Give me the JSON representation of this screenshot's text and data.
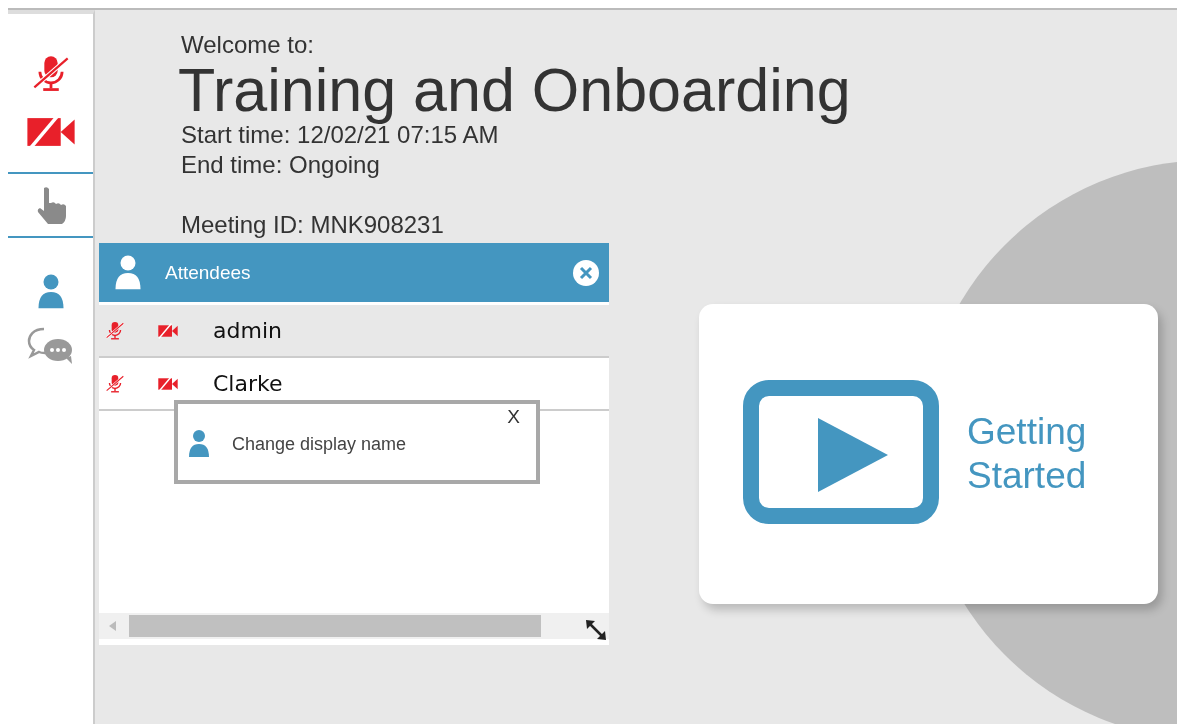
{
  "sidebar": [
    {
      "kind": "mic",
      "muted": true
    },
    {
      "kind": "camera",
      "muted": true
    },
    {
      "kind": "hand"
    },
    {
      "kind": "attendees",
      "selected": true
    },
    {
      "kind": "chat",
      "selected": false
    }
  ],
  "welcome": {
    "label": "Welcome to:",
    "title": "Training and Onboarding",
    "start_time": "Start time: 12/02/21 07:15 AM",
    "end_time": "End time: Ongoing",
    "meeting_id": "Meeting ID: MNK908231"
  },
  "attendees": {
    "title": "Attendees",
    "rows": [
      {
        "name": "admin",
        "selected": true,
        "mic_muted": true,
        "camera_off": true
      },
      {
        "name": "Clarke",
        "selected": false,
        "mic_muted": true,
        "camera_off": true
      }
    ],
    "popup": {
      "label": "Change display name",
      "close": "X"
    }
  },
  "card": {
    "label": "Getting Started"
  }
}
